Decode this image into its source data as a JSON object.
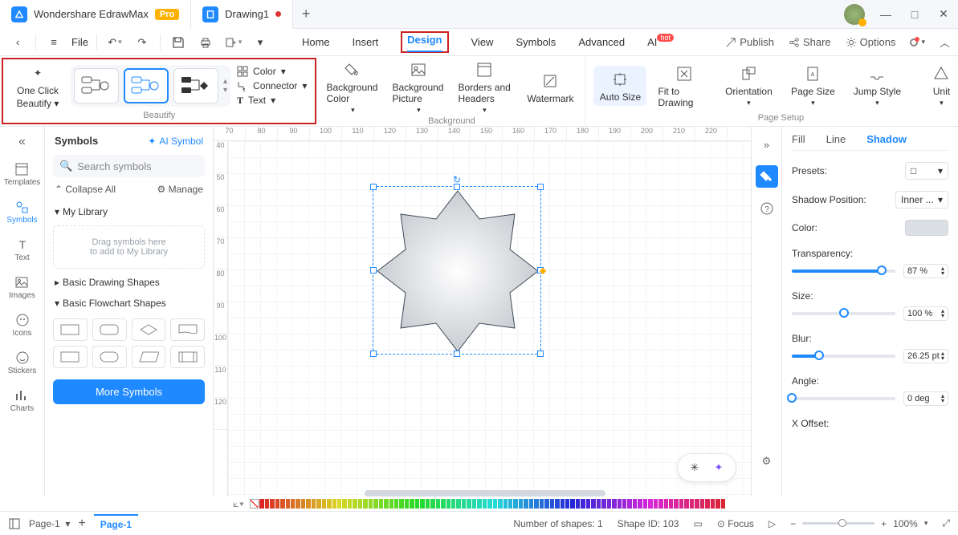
{
  "title": {
    "app": "Wondershare EdrawMax",
    "pro": "Pro",
    "doc": "Drawing1"
  },
  "menubar": {
    "file": "File"
  },
  "tabs": {
    "home": "Home",
    "insert": "Insert",
    "design": "Design",
    "view": "View",
    "symbols": "Symbols",
    "advanced": "Advanced",
    "ai": "AI",
    "hot": "hot"
  },
  "topright": {
    "publish": "Publish",
    "share": "Share",
    "options": "Options"
  },
  "ribbon": {
    "oneclick1": "One Click",
    "oneclick2": "Beautify",
    "beautify": "Beautify",
    "color": "Color",
    "connector": "Connector",
    "text": "Text",
    "bgcolor": "Background Color",
    "bgpic": "Background Picture",
    "borders": "Borders and Headers",
    "watermark": "Watermark",
    "backgroundGrp": "Background",
    "autosize": "Auto Size",
    "fit": "Fit to Drawing",
    "orient": "Orientation",
    "pagesize": "Page Size",
    "jump": "Jump Style",
    "unit": "Unit",
    "pagesetup": "Page Setup"
  },
  "leftrail": {
    "templates": "Templates",
    "symbols": "Symbols",
    "text": "Text",
    "images": "Images",
    "icons": "Icons",
    "stickers": "Stickers",
    "charts": "Charts"
  },
  "sym": {
    "title": "Symbols",
    "ai": "AI Symbol",
    "search": "Search symbols",
    "collapse": "Collapse All",
    "manage": "Manage",
    "mylib": "My Library",
    "drop1": "Drag symbols here",
    "drop2": "to add to My Library",
    "basic": "Basic Drawing Shapes",
    "flow": "Basic Flowchart Shapes",
    "more": "More Symbols"
  },
  "rulerTop": [
    "70",
    "80",
    "90",
    "100",
    "110",
    "120",
    "130",
    "140",
    "150",
    "160",
    "170",
    "180",
    "190",
    "200",
    "210",
    "220"
  ],
  "rulerLeft": [
    "40",
    "50",
    "60",
    "70",
    "80",
    "90",
    "100",
    "110",
    "120"
  ],
  "prop": {
    "fill": "Fill",
    "line": "Line",
    "shadow": "Shadow",
    "presets": "Presets:",
    "position": "Shadow Position:",
    "positionVal": "Inner ...",
    "color": "Color:",
    "transp": "Transparency:",
    "transpVal": "87 %",
    "size": "Size:",
    "sizeVal": "100 %",
    "blur": "Blur:",
    "blurVal": "26.25 pt",
    "angle": "Angle:",
    "angleVal": "0 deg",
    "xoff": "X Offset:"
  },
  "status": {
    "page": "Page-1",
    "pageTab": "Page-1",
    "shapes": "Number of shapes: 1",
    "shapeid": "Shape ID: 103",
    "focus": "Focus",
    "zoom": "100%"
  }
}
